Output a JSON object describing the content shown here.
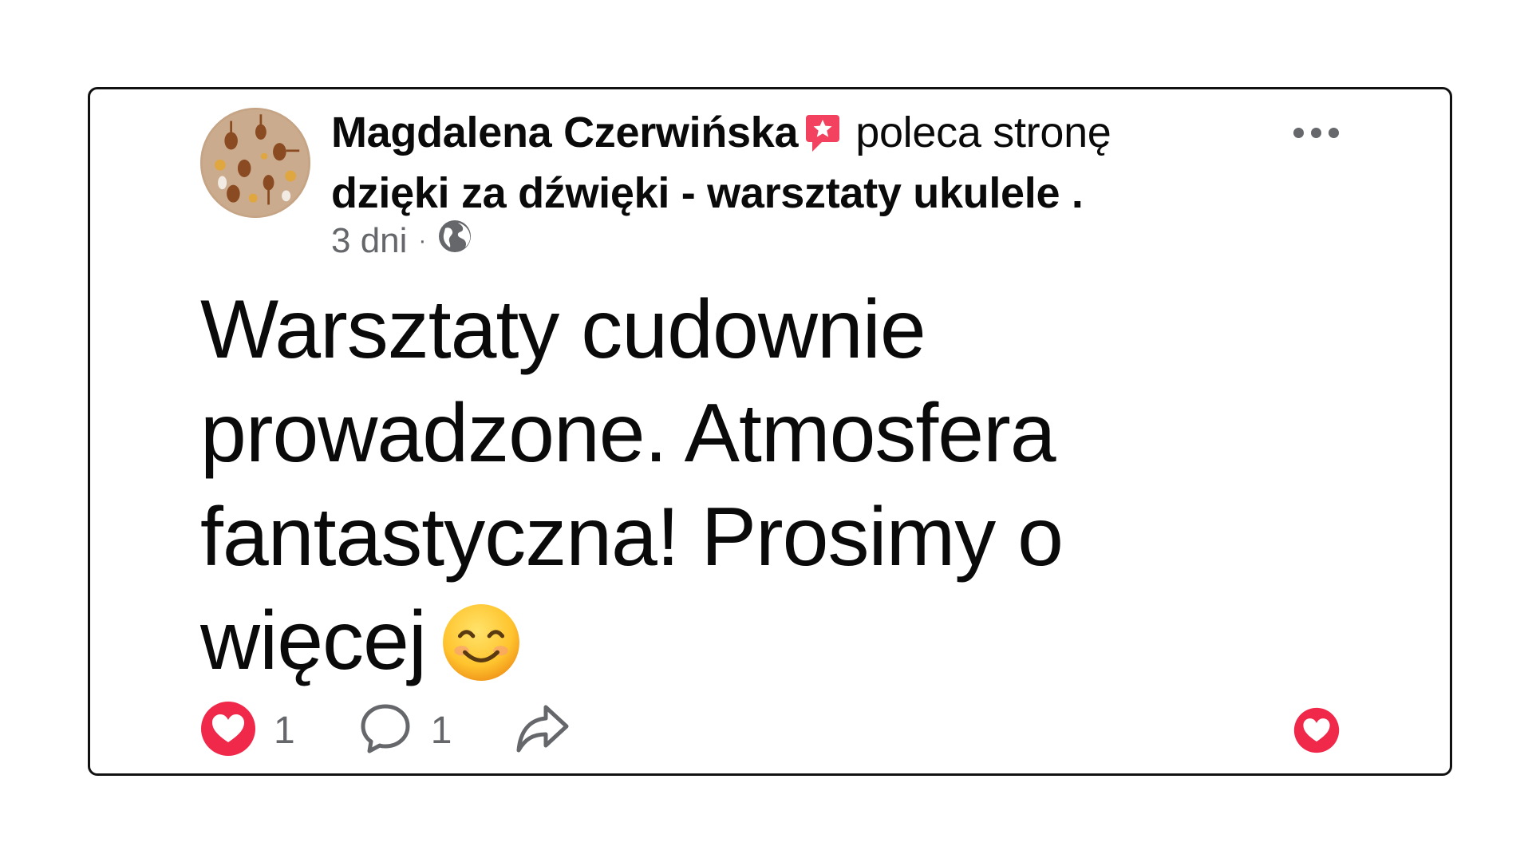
{
  "post": {
    "author": "Magdalena Czerwińska",
    "recommend_text": "poleca stronę",
    "page_name": "dzięki za dźwięki - warsztaty ukulele",
    "page_suffix": " .",
    "time": "3 dni",
    "separator": "·",
    "audience_icon": "globe-icon",
    "text": "Warsztaty cudownie prowadzone. Atmosfera fantastyczna! Prosimy o więcej",
    "emoji": "smiling-face-emoji"
  },
  "actions": {
    "like_count": "1",
    "comment_count": "1",
    "icons": [
      "heart-reaction-icon",
      "comment-icon",
      "share-icon",
      "heart-icon"
    ]
  },
  "colors": {
    "heart": "#f0284a",
    "badge": "#f3425f",
    "muted": "#65676b",
    "text": "#0a0a0a"
  }
}
